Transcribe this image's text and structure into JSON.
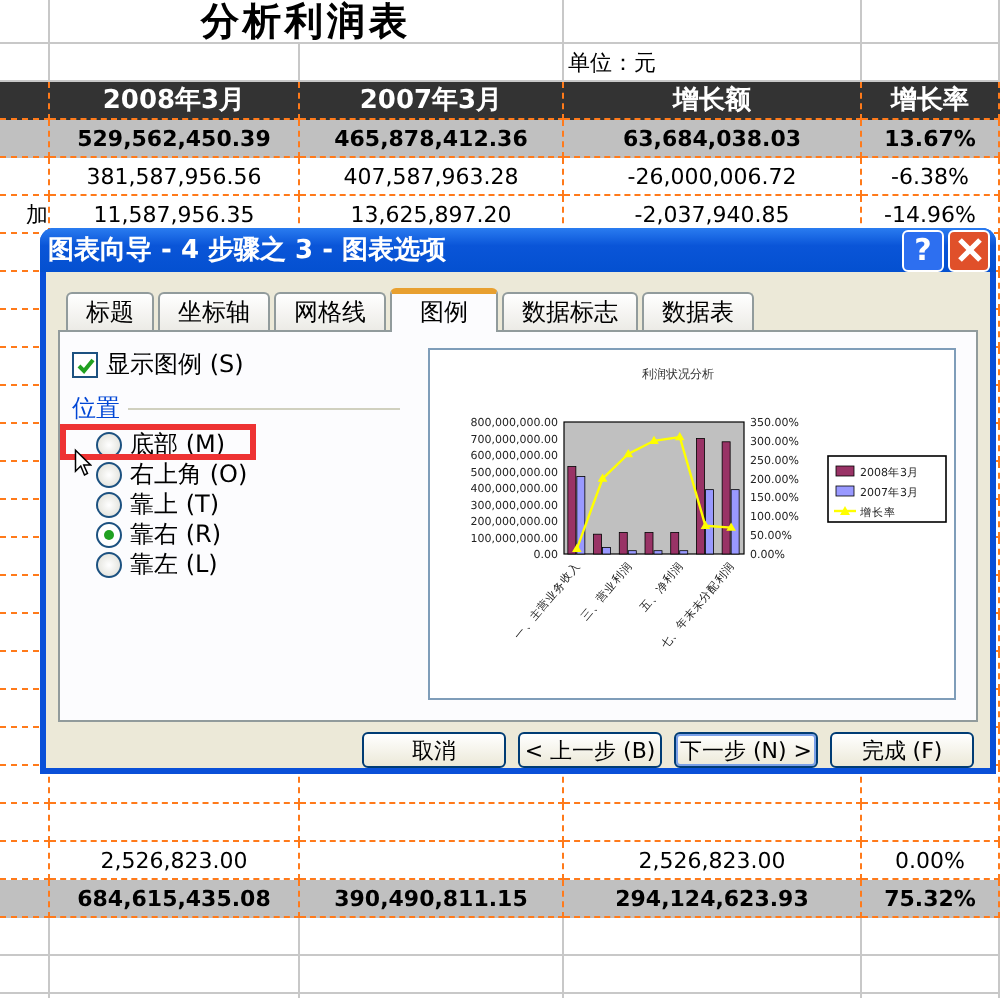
{
  "sheet": {
    "title": "分析利润表",
    "unit": "单位：元",
    "columns": [
      "2008年3月",
      "2007年3月",
      "增长额",
      "增长率"
    ],
    "rows_above": [
      {
        "kind": "total",
        "cells": [
          "529,562,450.39",
          "465,878,412.36",
          "63,684,038.03",
          "13.67%"
        ]
      },
      {
        "kind": "plain",
        "cells": [
          "381,587,956.56",
          "407,587,963.28",
          "-26,000,006.72",
          "-6.38%"
        ]
      },
      {
        "kind": "plain",
        "label": "加",
        "cells": [
          "11,587,956.35",
          "13,625,897.20",
          "-2,037,940.85",
          "-14.96%"
        ]
      }
    ],
    "rows_below": [
      {
        "kind": "plain",
        "cells": [
          "2,526,823.00",
          null,
          "2,526,823.00",
          "0.00%"
        ]
      },
      {
        "kind": "total",
        "cells": [
          "684,615,435.08",
          "390,490,811.15",
          "294,124,623.93",
          "75.32%"
        ]
      }
    ]
  },
  "dialog": {
    "title": "图表向导 - 4 步骤之 3 - 图表选项",
    "help": "?",
    "tabs": [
      {
        "label": "标题",
        "selected": false
      },
      {
        "label": "坐标轴",
        "selected": false
      },
      {
        "label": "网格线",
        "selected": false
      },
      {
        "label": "图例",
        "selected": true
      },
      {
        "label": "数据标志",
        "selected": false
      },
      {
        "label": "数据表",
        "selected": false
      }
    ],
    "show_legend": {
      "label": "显示图例 (S)",
      "checked": true
    },
    "position_heading": "位置",
    "positions": [
      {
        "label": "底部 (M)",
        "selected": false
      },
      {
        "label": "右上角 (O)",
        "selected": false
      },
      {
        "label": "靠上 (T)",
        "selected": false
      },
      {
        "label": "靠右 (R)",
        "selected": true
      },
      {
        "label": "靠左 (L)",
        "selected": false
      }
    ],
    "preview": {
      "chart_data": {
        "type": "bar",
        "title": "利润状况分析",
        "legend": "right",
        "categories": [
          "一、主营业务收入",
          null,
          "三、营业利润",
          null,
          "五、净利润",
          null,
          "七、年末未分配利润"
        ],
        "ylim": [
          0,
          800000000
        ],
        "y2lim": [
          0,
          350
        ],
        "yticks": [
          {
            "value": 0,
            "label": "0.00"
          },
          {
            "value": 100000000,
            "label": "100,000,000.00"
          },
          {
            "value": 200000000,
            "label": "200,000,000.00"
          },
          {
            "value": 300000000,
            "label": "300,000,000.00"
          },
          {
            "value": 400000000,
            "label": "400,000,000.00"
          },
          {
            "value": 500000000,
            "label": "500,000,000.00"
          },
          {
            "value": 600000000,
            "label": "600,000,000.00"
          },
          {
            "value": 700000000,
            "label": "700,000,000.00"
          },
          {
            "value": 800000000,
            "label": "800,000,000.00"
          }
        ],
        "y2ticks": [
          {
            "value": 0,
            "label": "0.00%"
          },
          {
            "value": 50,
            "label": "50.00%"
          },
          {
            "value": 100,
            "label": "100.00%"
          },
          {
            "value": 150,
            "label": "150.00%"
          },
          {
            "value": 200,
            "label": "200.00%"
          },
          {
            "value": 250,
            "label": "250.00%"
          },
          {
            "value": 300,
            "label": "300.00%"
          },
          {
            "value": 350,
            "label": "350.00%"
          }
        ],
        "series": [
          {
            "name": "2008年3月",
            "color": "#993366",
            "type": "bar",
            "values": [
              530000000,
              120000000,
              130000000,
              130000000,
              130000000,
              700000000,
              680000000
            ]
          },
          {
            "name": "2007年3月",
            "color": "#9999ff",
            "type": "bar",
            "values": [
              470000000,
              40000000,
              20000000,
              20000000,
              20000000,
              390000000,
              390000000
            ]
          },
          {
            "name": "增长率",
            "color": "#ffff00",
            "type": "line",
            "axis": "y2",
            "marker": "triangle",
            "values": [
              14,
              200,
              265,
              300,
              310,
              75,
              70
            ]
          }
        ]
      }
    },
    "buttons": [
      "取消",
      "< 上一步 (B)",
      "下一步 (N) >",
      "完成 (F)"
    ]
  }
}
